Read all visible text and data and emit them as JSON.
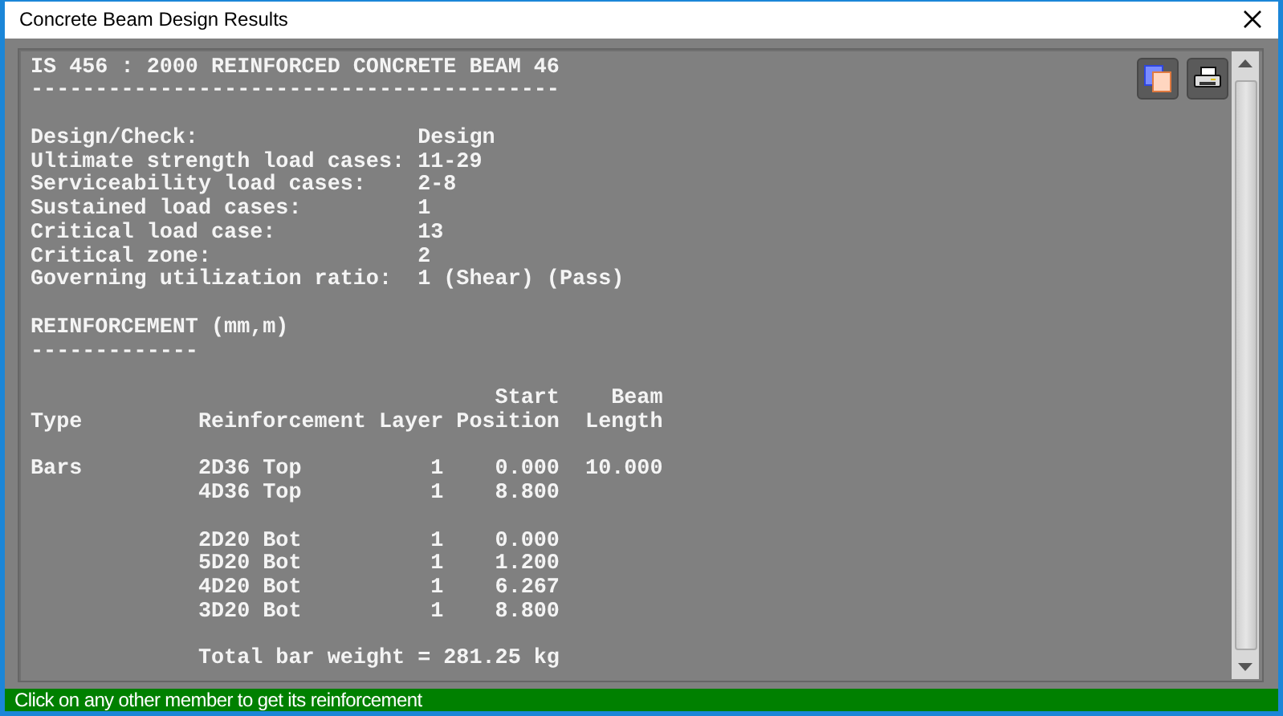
{
  "window": {
    "title": "Concrete Beam Design Results"
  },
  "report": {
    "blocks": [
      [
        "IS 456 : 2000 REINFORCED CONCRETE BEAM 46",
        "-----------------------------------------"
      ],
      [
        "Design/Check:                 Design",
        "Ultimate strength load cases: 11-29",
        "Serviceability load cases:    2-8",
        "Sustained load cases:         1",
        "Critical load case:           13",
        "Critical zone:                2",
        "Governing utilization ratio:  1 (Shear) (Pass)"
      ],
      [
        "REINFORCEMENT (mm,m)",
        "-------------"
      ],
      [
        "                                    Start    Beam",
        "Type         Reinforcement Layer Position  Length"
      ],
      [
        "Bars         2D36 Top          1    0.000  10.000",
        "             4D36 Top          1    8.800"
      ],
      [
        "             2D20 Bot          1    0.000",
        "             5D20 Bot          1    1.200",
        "             4D20 Bot          1    6.267",
        "             3D20 Bot          1    8.800"
      ],
      [
        "             Total bar weight = 281.25 kg"
      ]
    ]
  },
  "status_bar": "Click on any other member to get its reinforcement"
}
